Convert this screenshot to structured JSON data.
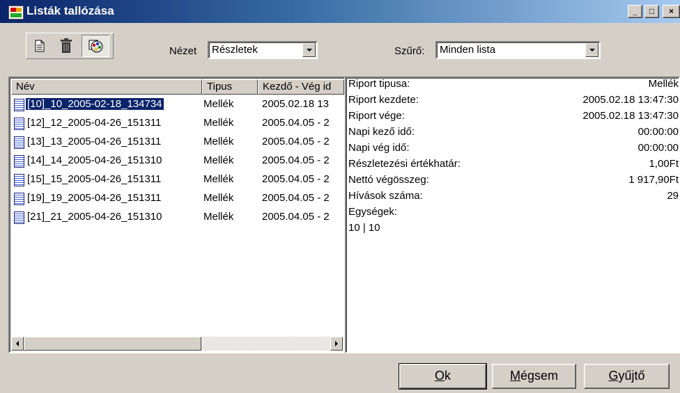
{
  "window": {
    "title": "Listák tallózása",
    "controls": {
      "minimize": "_",
      "maximize": "□",
      "close": "×"
    }
  },
  "toolbar": {
    "buttons": [
      {
        "icon": "document-icon"
      },
      {
        "icon": "trash-icon"
      },
      {
        "icon": "palette-icon",
        "pressed": true
      }
    ]
  },
  "view": {
    "label": "Nézet",
    "selected": "Részletek"
  },
  "filter": {
    "label": "Szűrő:",
    "selected": "Minden lista"
  },
  "list": {
    "columns": [
      "Név",
      "Tipus",
      "Kezdő - Vég id"
    ],
    "rows": [
      {
        "name": "[10]_10_2005-02-18_134734",
        "type": "Mellék",
        "date": "2005.02.18 13",
        "selected": true
      },
      {
        "name": "[12]_12_2005-04-26_151311",
        "type": "Mellék",
        "date": "2005.04.05 - 2"
      },
      {
        "name": "[13]_13_2005-04-26_151311",
        "type": "Mellék",
        "date": "2005.04.05 - 2"
      },
      {
        "name": "[14]_14_2005-04-26_151310",
        "type": "Mellék",
        "date": "2005.04.05 - 2"
      },
      {
        "name": "[15]_15_2005-04-26_151311",
        "type": "Mellék",
        "date": "2005.04.05 - 2"
      },
      {
        "name": "[19]_19_2005-04-26_151311",
        "type": "Mellék",
        "date": "2005.04.05 - 2"
      },
      {
        "name": "[21]_21_2005-04-26_151310",
        "type": "Mellék",
        "date": "2005.04.05 - 2"
      }
    ]
  },
  "details": {
    "rows": [
      {
        "label": "Riport tipusa:",
        "value": "Mellék"
      },
      {
        "label": "Riport kezdete:",
        "value": "2005.02.18 13:47:30"
      },
      {
        "label": "Riport vége:",
        "value": "2005.02.18 13:47:30"
      },
      {
        "label": "Napi kező idő:",
        "value": "00:00:00"
      },
      {
        "label": "Napi vég idő:",
        "value": "00:00:00"
      },
      {
        "label": "Részletezési értékhatár:",
        "value": "1,00Ft"
      },
      {
        "label": "Nettó végösszeg:",
        "value": "1 917,90Ft"
      },
      {
        "label": "Hívások száma:",
        "value": "29"
      },
      {
        "label": "Egységek:",
        "value": ""
      }
    ],
    "units_value": "10 | 10"
  },
  "buttons": {
    "ok": {
      "mnemonic": "O",
      "rest": "k"
    },
    "cancel": {
      "mnemonic": "M",
      "rest": "égsem"
    },
    "collect": {
      "mnemonic": "G",
      "rest": "yűjtő"
    }
  }
}
